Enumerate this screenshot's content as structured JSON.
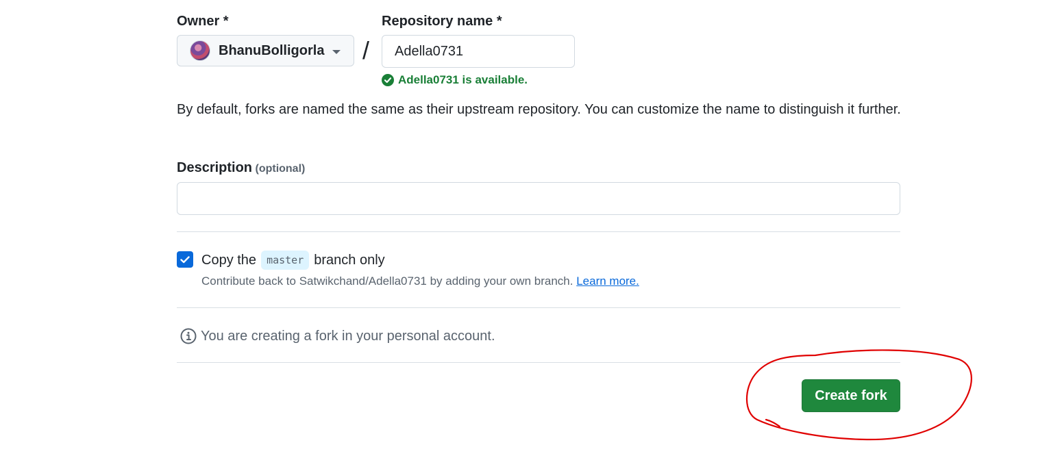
{
  "owner": {
    "label": "Owner *",
    "selected_value": "BhanuBolligorla",
    "avatar_icon": "user-avatar",
    "caret_icon": "caret-down-icon"
  },
  "separator": "/",
  "repository": {
    "label": "Repository name *",
    "value": "Adella0731",
    "availability_message": "Adella0731 is available.",
    "availability_icon": "check-circle-icon",
    "status_color": "#1a7f37"
  },
  "help_text": "By default, forks are named the same as their upstream repository. You can customize the name to distinguish it further.",
  "description": {
    "label": "Description",
    "optional_label": "(optional)",
    "value": ""
  },
  "copy_branch": {
    "checked": true,
    "prefix": "Copy the",
    "branch": "master",
    "suffix": "branch only",
    "helper_text": "Contribute back to Satwikchand/Adella0731 by adding your own branch.",
    "learn_more_label": "Learn more."
  },
  "notice": {
    "icon": "info-icon",
    "text": "You are creating a fork in your personal account."
  },
  "create_button": {
    "label": "Create fork",
    "color": "#1f883d"
  },
  "annotation": {
    "type": "hand-drawn circle",
    "color": "#e00000"
  }
}
